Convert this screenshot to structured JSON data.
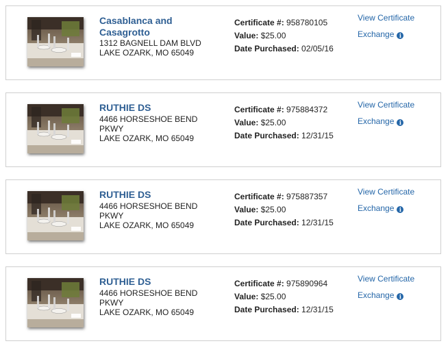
{
  "certificates": [
    {
      "name": "Casablanca and Casagrotto",
      "address_lines": [
        "1312 BAGNELL DAM BLVD",
        "LAKE OZARK, MO 65049"
      ],
      "certificate_label": "Certificate #:",
      "certificate_number": "958780105",
      "value_label": "Value:",
      "value": "$25.00",
      "date_label": "Date Purchased:",
      "date": "02/05/16",
      "view_label": "View Certificate",
      "exchange_label": "Exchange",
      "info_icon": "info-icon"
    },
    {
      "name": "RUTHIE DS",
      "address_lines": [
        "4466 HORSESHOE BEND",
        "PKWY",
        "LAKE OZARK, MO 65049"
      ],
      "certificate_label": "Certificate #:",
      "certificate_number": "975884372",
      "value_label": "Value:",
      "value": "$25.00",
      "date_label": "Date Purchased:",
      "date": "12/31/15",
      "view_label": "View Certificate",
      "exchange_label": "Exchange",
      "info_icon": "info-icon"
    },
    {
      "name": "RUTHIE DS",
      "address_lines": [
        "4466 HORSESHOE BEND",
        "PKWY",
        "LAKE OZARK, MO 65049"
      ],
      "certificate_label": "Certificate #:",
      "certificate_number": "975887357",
      "value_label": "Value:",
      "value": "$25.00",
      "date_label": "Date Purchased:",
      "date": "12/31/15",
      "view_label": "View Certificate",
      "exchange_label": "Exchange",
      "info_icon": "info-icon"
    },
    {
      "name": "RUTHIE DS",
      "address_lines": [
        "4466 HORSESHOE BEND",
        "PKWY",
        "LAKE OZARK, MO 65049"
      ],
      "certificate_label": "Certificate #:",
      "certificate_number": "975890964",
      "value_label": "Value:",
      "value": "$25.00",
      "date_label": "Date Purchased:",
      "date": "12/31/15",
      "view_label": "View Certificate",
      "exchange_label": "Exchange",
      "info_icon": "info-icon"
    }
  ],
  "colors": {
    "accent": "#2f5f93",
    "link": "#2466a8",
    "border": "#cfcfcf",
    "text": "#222222"
  }
}
